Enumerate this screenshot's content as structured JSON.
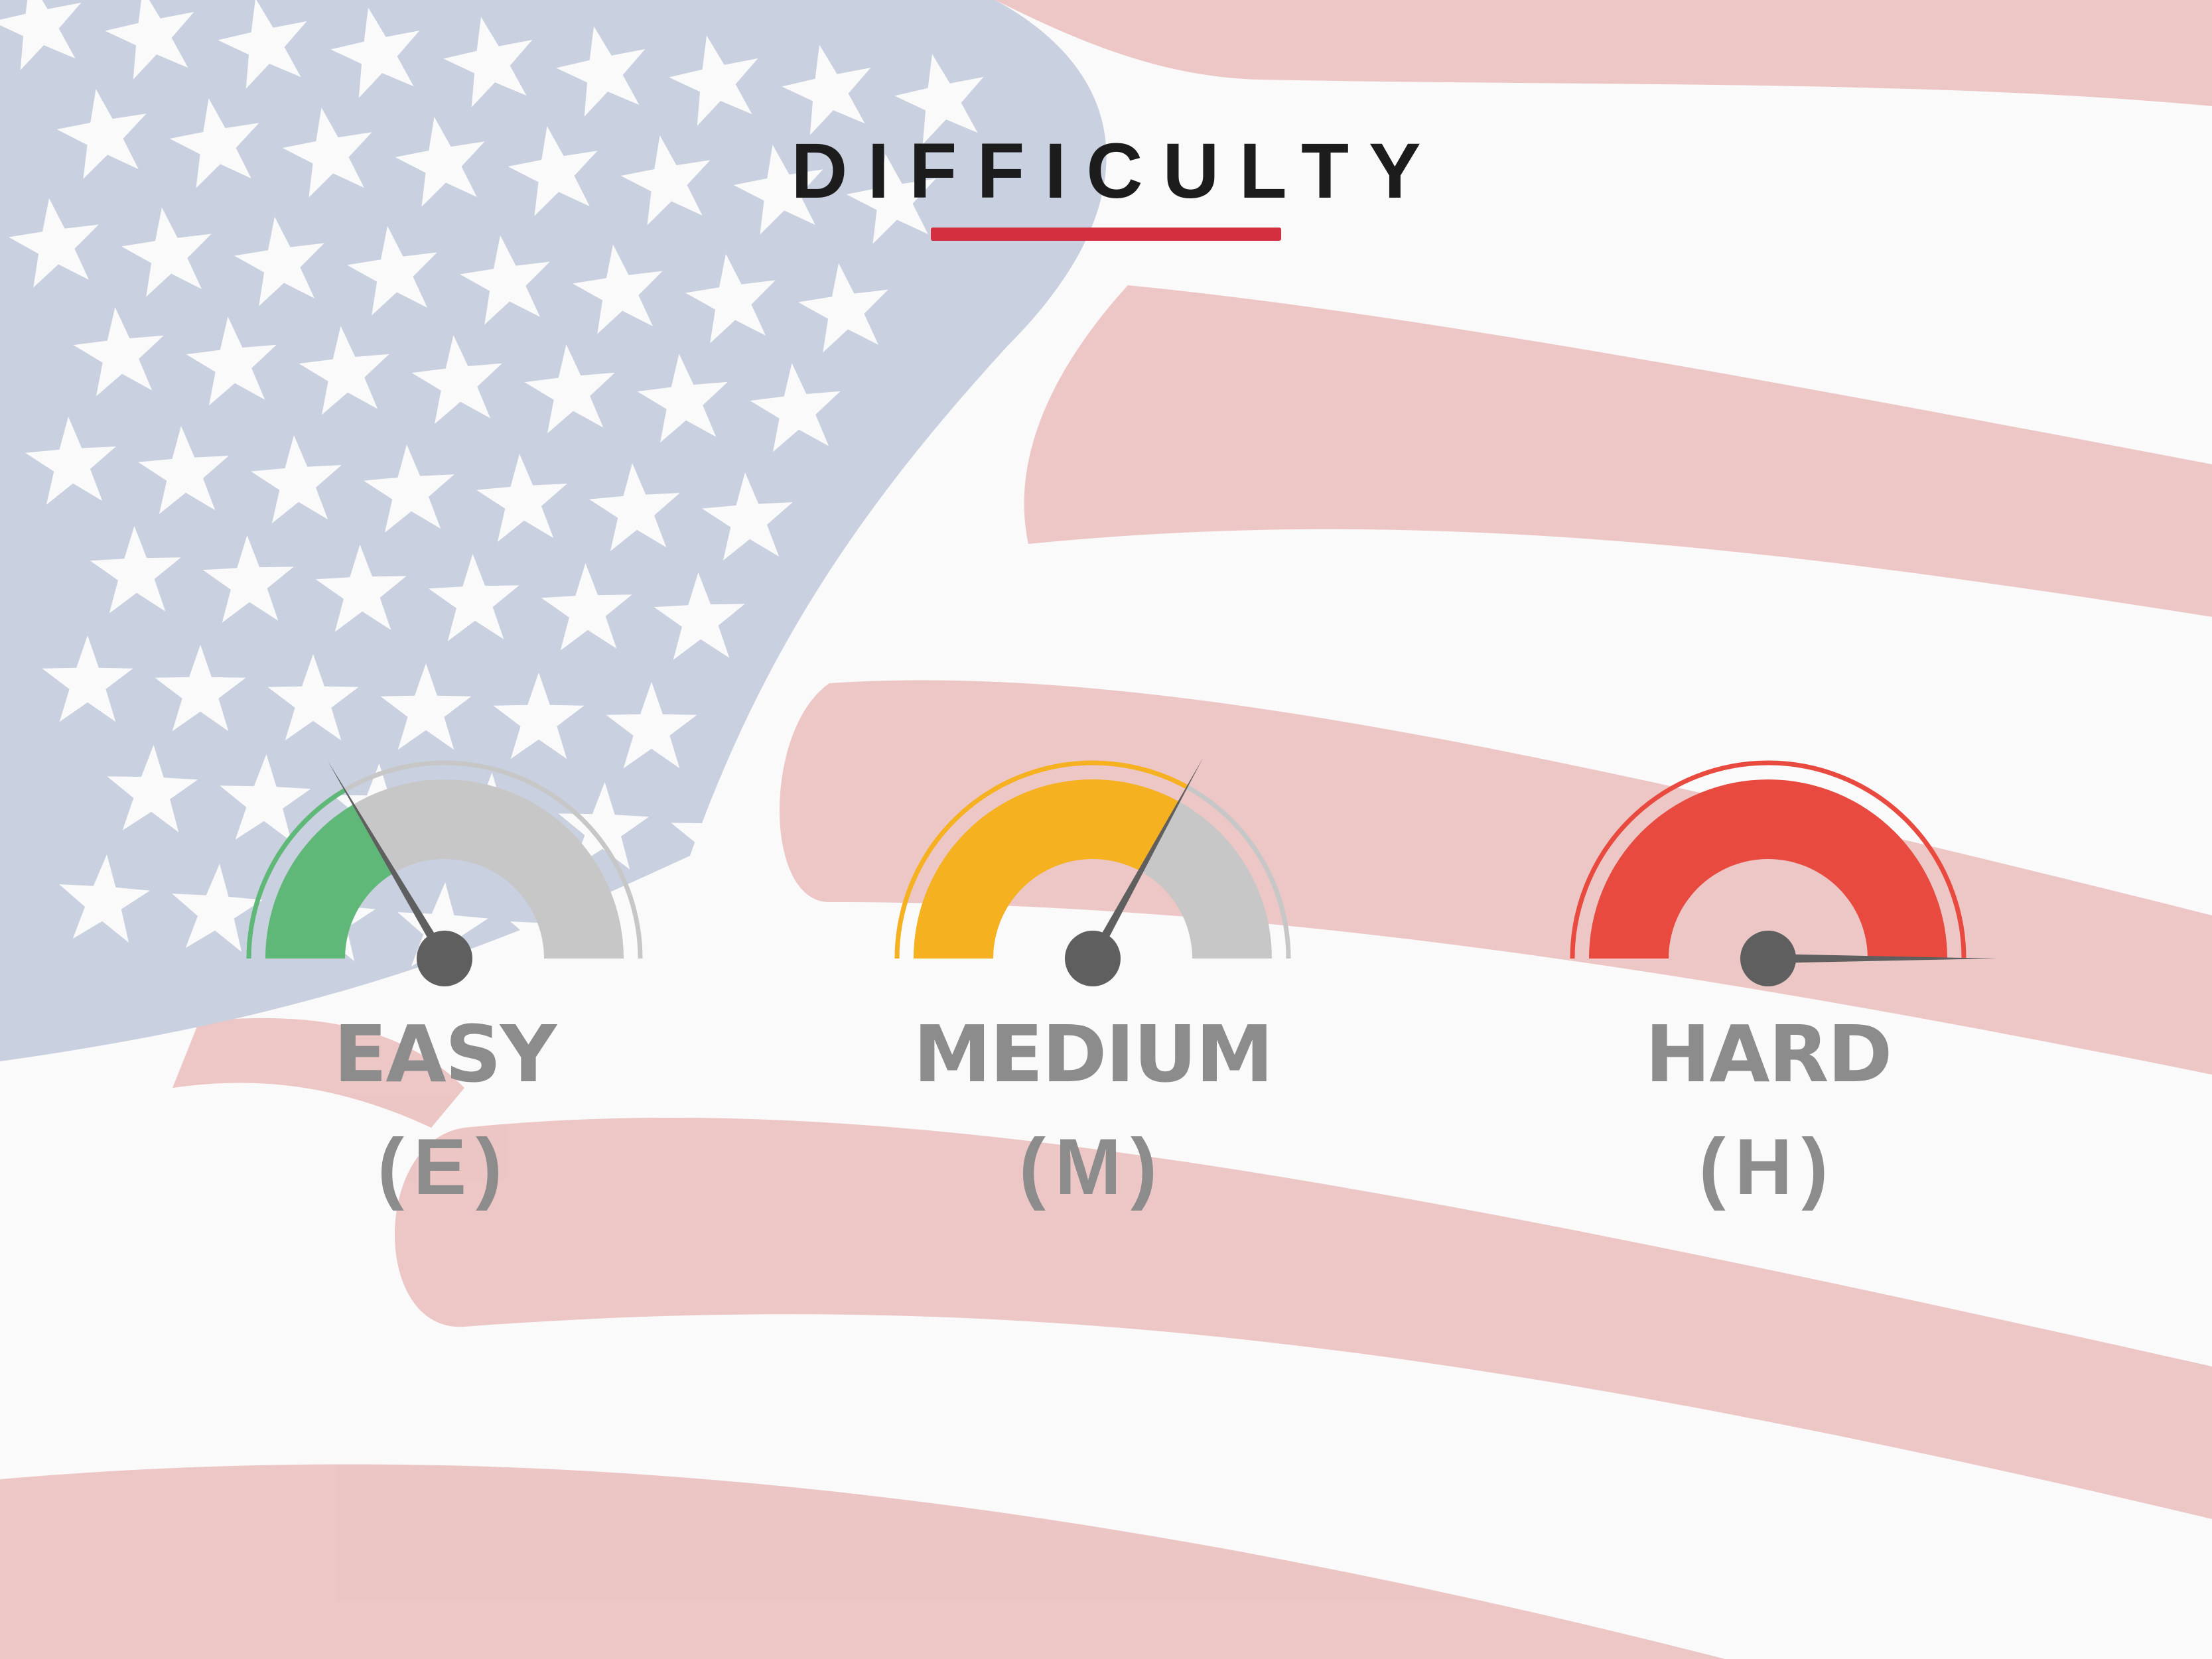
{
  "title": "DIFFICULTY",
  "colors": {
    "title_text": "#1c1c1c",
    "underline": "#d32f3e",
    "easy": "#5fb878",
    "medium": "#f5b120",
    "hard": "#e84a3f",
    "gauge_track": "#c7c7c7",
    "needle": "#5f5f5f",
    "label_text": "#8c8c8c",
    "flag_blue": "#c9d0e0",
    "flag_red": "#ecc3c3",
    "flag_white": "#fbfafa"
  },
  "levels": [
    {
      "id": "easy",
      "label": "EASY",
      "code": "(E)",
      "level": 0.33
    },
    {
      "id": "medium",
      "label": "MEDIUM",
      "code": "(M)",
      "level": 0.66
    },
    {
      "id": "hard",
      "label": "HARD",
      "code": "(H)",
      "level": 1.0
    }
  ]
}
